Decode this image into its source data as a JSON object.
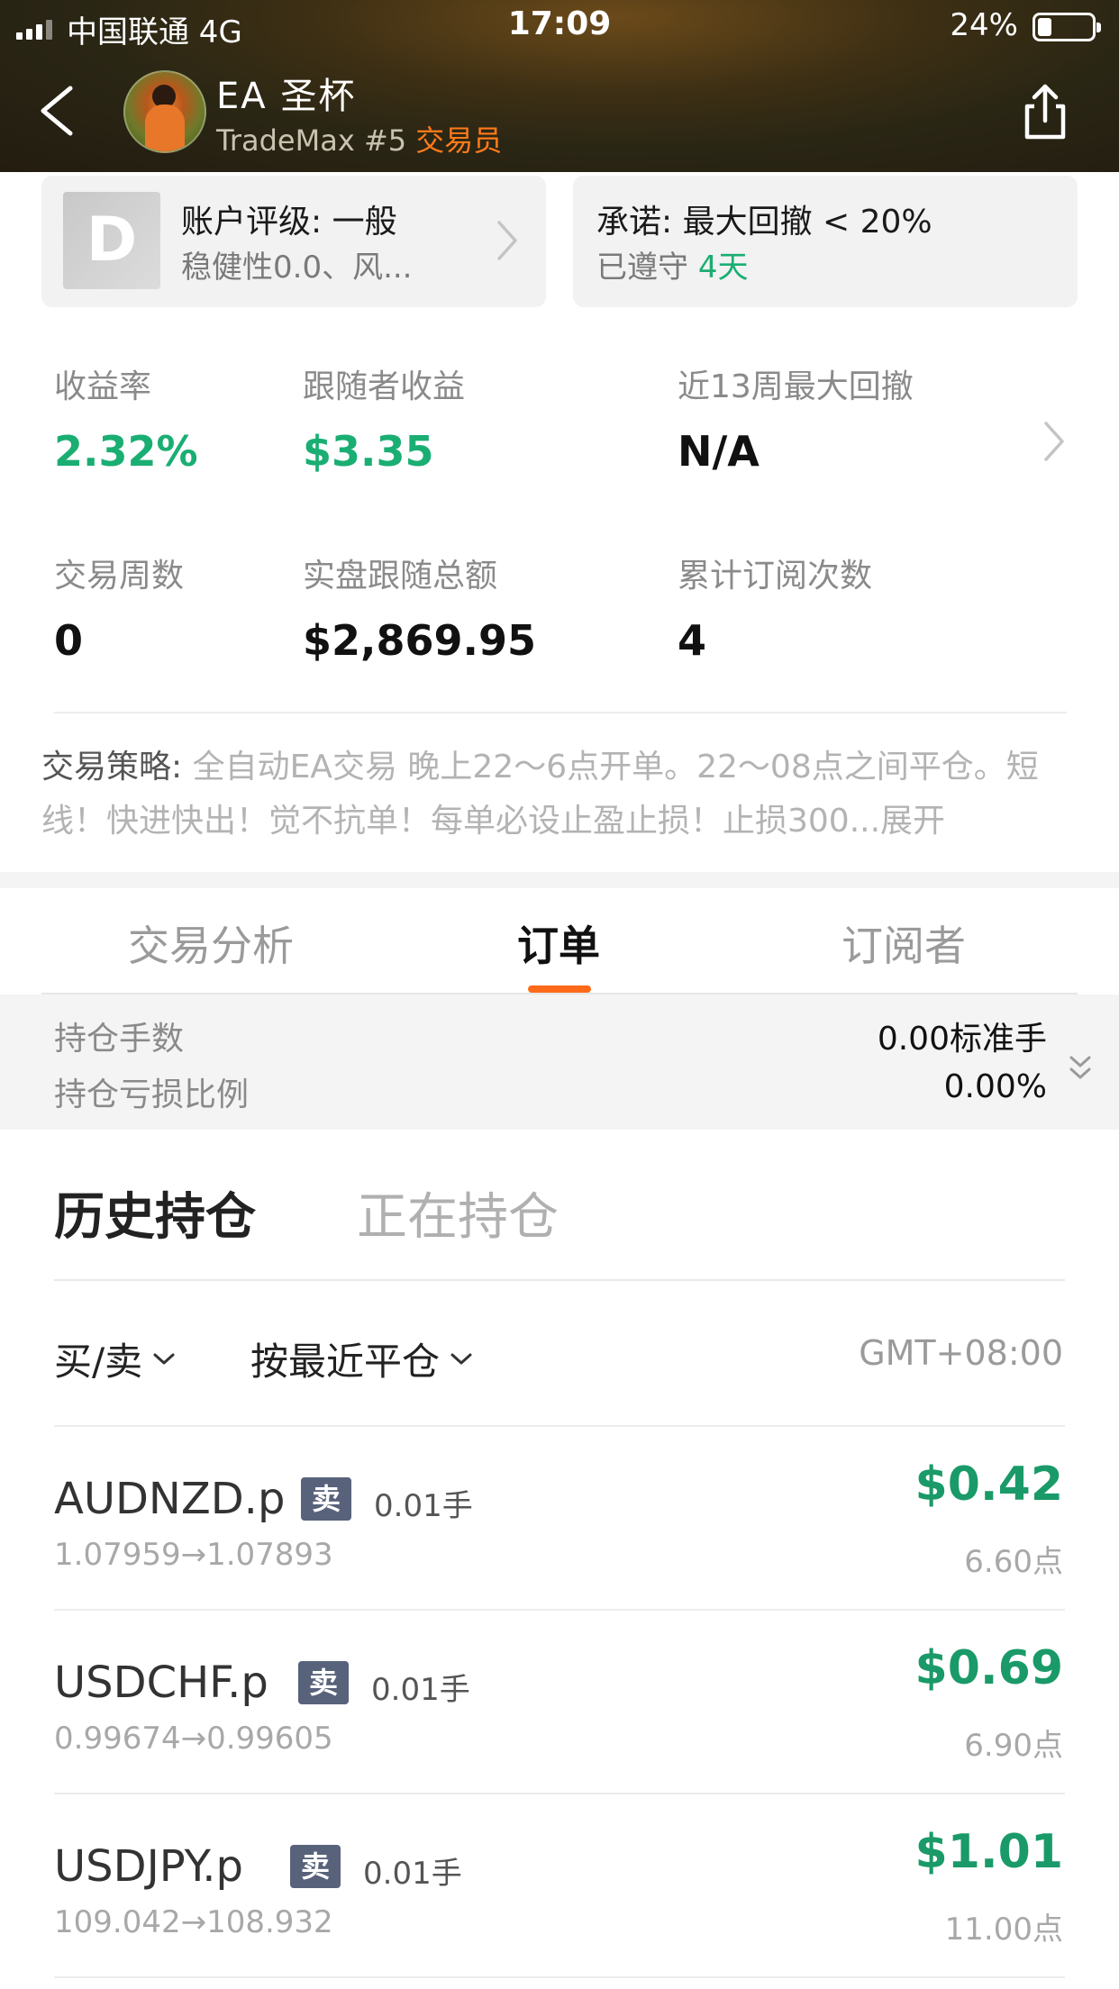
{
  "status_bar": {
    "carrier": "中国联通  4G",
    "time": "17:09",
    "battery": "24%"
  },
  "header": {
    "trader_name": "EA  圣杯",
    "subtitle_prefix": "TradeMax #5 ",
    "subtitle_role": "交易员"
  },
  "cards": {
    "rating_badge": "D",
    "rating_title": "账户评级: 一般",
    "rating_sub": "稳健性0.0、风...",
    "promise_title": "承诺: 最大回撤 < 20%",
    "promise_sub_prefix": "已遵守 ",
    "promise_days": "4天"
  },
  "stats": {
    "return_label": "收益率",
    "return_value": "2.32%",
    "follower_profit_label": "跟随者收益",
    "follower_profit_value": "$3.35",
    "max_drawdown_label": "近13周最大回撤",
    "max_drawdown_value": "N/A",
    "weeks_label": "交易周数",
    "weeks_value": "0",
    "follow_total_label": "实盘跟随总额",
    "follow_total_value": "$2,869.95",
    "subs_label": "累计订阅次数",
    "subs_value": "4"
  },
  "strategy": {
    "label": "交易策略: ",
    "text": "全自动EA交易 晚上22～6点开单。22～08点之间平仓。短线！快进快出！觉不抗单！每单必设止盈止损！止损300...",
    "expand": "展开"
  },
  "tabs": [
    "交易分析",
    "订单",
    "订阅者"
  ],
  "summary": {
    "lots_label": "持仓手数",
    "lots_value": "0.00标准手",
    "loss_label": "持仓亏损比例",
    "loss_value": "0.00%"
  },
  "subtabs": {
    "history": "历史持仓",
    "open": "正在持仓"
  },
  "filters": {
    "side": "买/卖",
    "sort": "按最近平仓",
    "timezone": "GMT+08:00"
  },
  "orders": [
    {
      "symbol": "AUDNZD.p",
      "side": "卖",
      "lots": "0.01手",
      "price": "1.07959→1.07893",
      "profit": "$0.42",
      "points": "6.60点"
    },
    {
      "symbol": "USDCHF.p",
      "side": "卖",
      "lots": "0.01手",
      "price": "0.99674→0.99605",
      "profit": "$0.69",
      "points": "6.90点"
    },
    {
      "symbol": "USDJPY.p",
      "side": "卖",
      "lots": "0.01手",
      "price": "109.042→108.932",
      "profit": "$1.01",
      "points": "11.00点"
    }
  ]
}
